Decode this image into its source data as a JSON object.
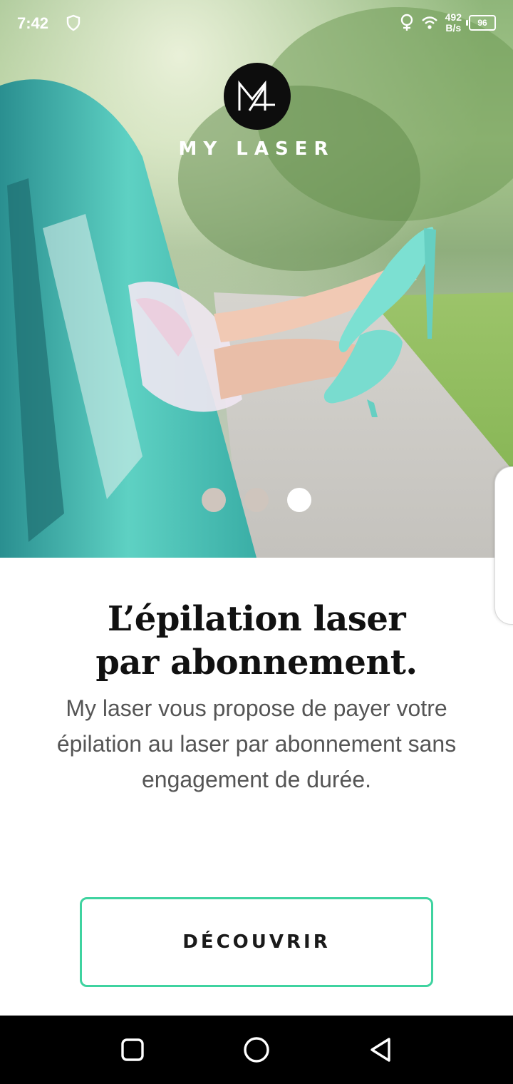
{
  "status_bar": {
    "time": "7:42",
    "net_speed_value": "492",
    "net_speed_unit": "B/s",
    "battery": "96"
  },
  "brand": {
    "name": "MY LASER"
  },
  "carousel": {
    "total_slides": 3,
    "active_index": 2
  },
  "content": {
    "headline_line1": "L’épilation laser",
    "headline_line2": "par abonnement.",
    "description": "My laser vous propose de payer votre épilation au laser par abonnement sans engagement de durée."
  },
  "cta": {
    "label": "DÉCOUVRIR"
  },
  "colors": {
    "accent": "#3fd3a0",
    "text_dark": "#111111",
    "text_body": "#555555",
    "dot_inactive": "#cfc5bd",
    "dot_active": "#ffffff"
  }
}
